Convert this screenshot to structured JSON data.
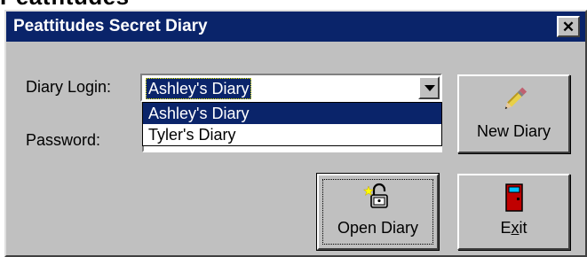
{
  "top_fragment": "Peatfitudes",
  "window": {
    "title": "Peattitudes Secret Diary",
    "close_glyph": "✕"
  },
  "login": {
    "label": "Diary Login:",
    "selected_value": "Ashley's Diary",
    "options": [
      "Ashley's Diary",
      "Tyler's Diary"
    ]
  },
  "password": {
    "label": "Password:"
  },
  "buttons": {
    "new_diary": "New Diary",
    "open_diary": "Open Diary",
    "exit_prefix": "E",
    "exit_underlined": "x",
    "exit_suffix": "it"
  },
  "icons": {
    "new_diary": "pencil-icon",
    "open_diary": "padlock-open-icon",
    "exit": "door-icon"
  },
  "colors": {
    "title_bar": "#0a246a",
    "window_face": "#c0c0c0",
    "selection": "#0a246a"
  }
}
